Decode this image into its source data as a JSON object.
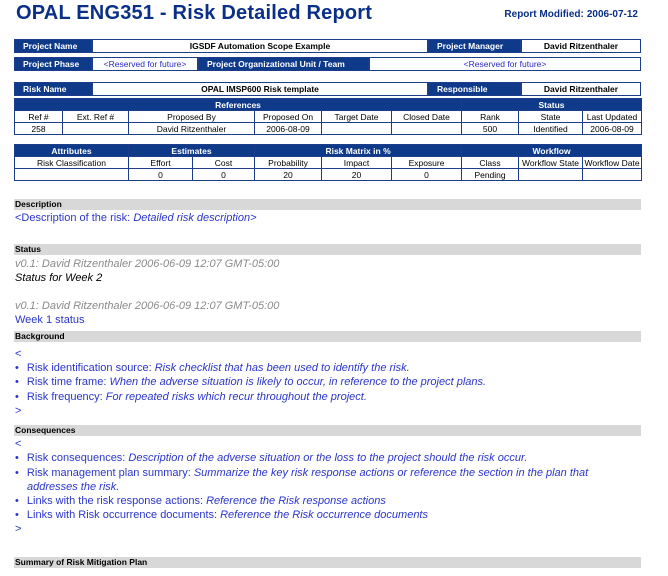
{
  "header": {
    "title": "OPAL ENG351 - Risk Detailed Report",
    "modified_label": "Report Modified:",
    "modified_date": "2006-07-12"
  },
  "project": {
    "name_label": "Project Name",
    "name_value": "IGSDF Automation Scope Example",
    "manager_label": "Project Manager",
    "manager_value": "David Ritzenthaler",
    "phase_label": "Project Phase",
    "phase_value": "<Reserved for future>",
    "unit_label": "Project Organizational Unit / Team",
    "unit_value": "<Reserved for future>"
  },
  "risk": {
    "name_label": "Risk Name",
    "name_value": "OPAL IMSP600 Risk template",
    "responsible_label": "Responsible",
    "responsible_value": "David Ritzenthaler"
  },
  "references_table": {
    "group_references": "References",
    "group_status": "Status",
    "headers": [
      "Ref #",
      "Ext. Ref #",
      "Proposed By",
      "Proposed On",
      "Target Date",
      "Closed Date",
      "Rank",
      "State",
      "Last Updated"
    ],
    "values": [
      "258",
      "",
      "David Ritzenthaler",
      "2006-08-09",
      "",
      "",
      "500",
      "Identified",
      "2006-08-09"
    ]
  },
  "attributes_table": {
    "group_attributes": "Attributes",
    "group_estimates": "Estimates",
    "group_matrix": "Risk Matrix in %",
    "group_workflow": "Workflow",
    "headers": [
      "Risk Classification",
      "Effort",
      "Cost",
      "Probability",
      "Impact",
      "Exposure",
      "Class",
      "Workflow State",
      "Workflow Date"
    ],
    "values": [
      "",
      "0",
      "0",
      "20",
      "20",
      "0",
      "Pending",
      "",
      ""
    ]
  },
  "description": {
    "title": "Description",
    "prefix": "<Description of the risk: ",
    "text": "Detailed risk description>"
  },
  "status": {
    "title": "Status",
    "entries": [
      {
        "meta": "v0.1: David Ritzenthaler 2006-06-09 12:07 GMT-05:00",
        "text": "Status for Week 2"
      },
      {
        "meta": "v0.1: David Ritzenthaler 2006-06-09 12:07 GMT-05:00",
        "text": "Week 1 status"
      }
    ]
  },
  "background": {
    "title": "Background",
    "open": "<",
    "items": [
      {
        "label": "Risk identification source: ",
        "text": "Risk checklist that has been used to identify the risk."
      },
      {
        "label": "Risk time frame: ",
        "text": "When the adverse situation is likely to occur, in reference to the project plans."
      },
      {
        "label": "Risk frequency: ",
        "text": "For repeated risks which recur throughout the project."
      }
    ],
    "close": ">"
  },
  "consequences": {
    "title": "Consequences",
    "open": "<",
    "items": [
      {
        "label": "Risk consequences: ",
        "text": "Description of the adverse situation or the loss to the project should the risk occur."
      },
      {
        "label": "Risk management plan summary: ",
        "text": "Summarize the key risk response actions or reference the section in the plan that",
        "text2": "addresses the risk."
      },
      {
        "label": "Links with the risk response actions: ",
        "text": "Reference the Risk response actions"
      },
      {
        "label": "Links with Risk occurrence documents: ",
        "text": "Reference the Risk occurrence documents"
      }
    ],
    "close": ">"
  },
  "mitigation": {
    "title": "Summary of Risk Mitigation Plan"
  }
}
